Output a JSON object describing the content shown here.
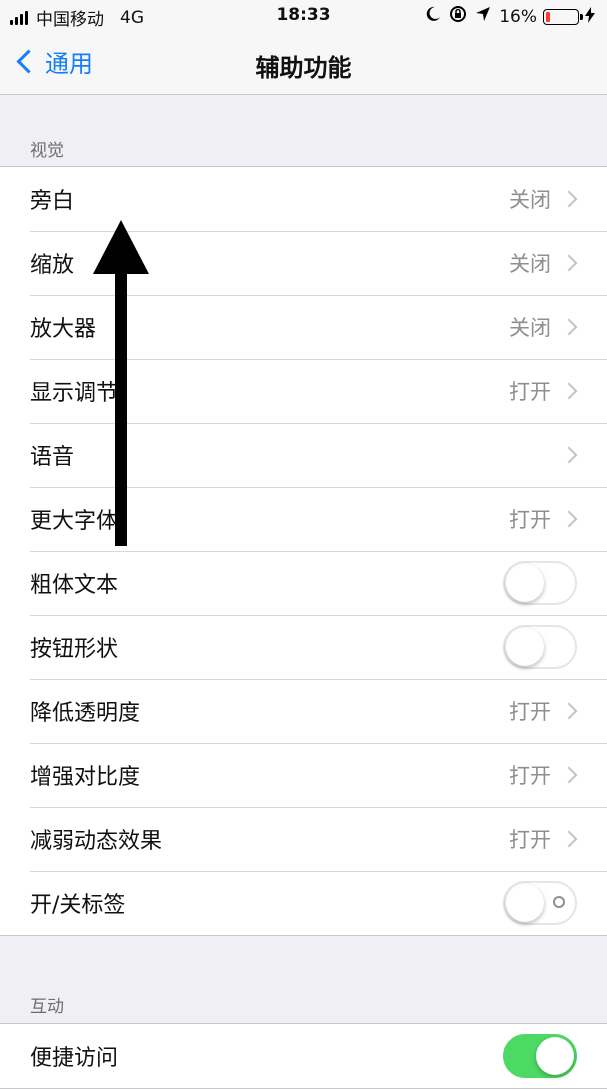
{
  "status_bar": {
    "carrier": "中国移动",
    "network": "4G",
    "time": "18:33",
    "battery": "16%",
    "battery_level": 0.16,
    "battery_color": "#ff3b30"
  },
  "nav": {
    "back_label": "通用",
    "title": "辅助功能",
    "accent_color": "#147efb"
  },
  "sections": {
    "vision": {
      "header": "视觉",
      "rows": [
        {
          "label": "旁白",
          "value": "关闭"
        },
        {
          "label": "缩放",
          "value": "关闭"
        },
        {
          "label": "放大器",
          "value": "关闭"
        },
        {
          "label": "显示调节",
          "value": "打开"
        },
        {
          "label": "语音",
          "value": ""
        },
        {
          "label": "更大字体",
          "value": "打开"
        },
        {
          "label": "粗体文本",
          "toggle": "off"
        },
        {
          "label": "按钮形状",
          "toggle": "off"
        },
        {
          "label": "降低透明度",
          "value": "打开"
        },
        {
          "label": "增强对比度",
          "value": "打开"
        },
        {
          "label": "减弱动态效果",
          "value": "打开"
        },
        {
          "label": "开/关标签",
          "toggle": "off"
        }
      ]
    },
    "interaction": {
      "header": "互动",
      "rows": [
        {
          "label": "便捷访问",
          "toggle": "on"
        }
      ]
    }
  },
  "toggle_on_color": "#4cd964"
}
